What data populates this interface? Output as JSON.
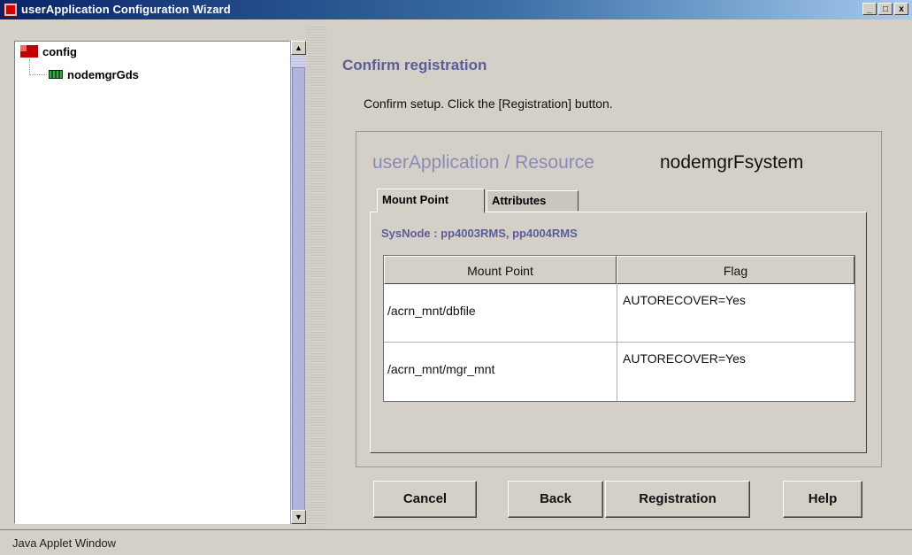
{
  "window": {
    "title": "userApplication Configuration Wizard",
    "controls": {
      "minimize": "_",
      "maximize": "□",
      "close": "x"
    }
  },
  "tree": {
    "root": {
      "label": "config",
      "icon": "config-folder-icon"
    },
    "children": [
      {
        "label": "nodemgrGds",
        "icon": "gds-node-icon"
      }
    ]
  },
  "main": {
    "heading": "Confirm registration",
    "instruction": "Confirm setup.  Click the [Registration] button.",
    "resource_label": "userApplication / Resource",
    "resource_name": "nodemgrFsystem",
    "tabs": [
      {
        "label": "Mount Point",
        "active": true
      },
      {
        "label": "Attributes",
        "active": false
      }
    ],
    "sysnode": "SysNode : pp4003RMS, pp4004RMS",
    "table": {
      "columns": [
        "Mount Point",
        "Flag"
      ],
      "rows": [
        [
          "/acrn_mnt/dbfile",
          "AUTORECOVER=Yes"
        ],
        [
          "/acrn_mnt/mgr_mnt",
          "AUTORECOVER=Yes"
        ]
      ]
    }
  },
  "buttons": {
    "cancel": "Cancel",
    "back": "Back",
    "registration": "Registration",
    "help": "Help"
  },
  "status": {
    "text": "Java Applet Window"
  },
  "colors": {
    "titlebar_start": "#0a246a",
    "heading": "#5c5c9a",
    "resource_label": "#8a8ab8"
  }
}
